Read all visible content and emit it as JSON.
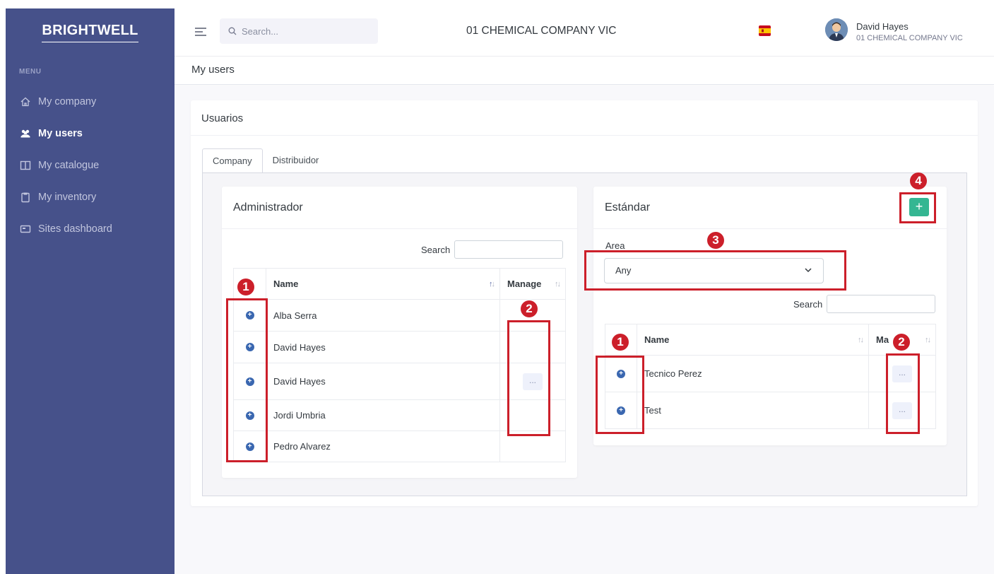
{
  "brand": "BRIGHTWELL",
  "sidebar": {
    "menu_title": "MENU",
    "items": [
      {
        "label": "My company",
        "icon": "home-icon"
      },
      {
        "label": "My users",
        "icon": "users-icon"
      },
      {
        "label": "My catalogue",
        "icon": "book-icon"
      },
      {
        "label": "My inventory",
        "icon": "clipboard-icon"
      },
      {
        "label": "Sites dashboard",
        "icon": "dashboard-icon"
      }
    ],
    "active_index": 1
  },
  "topbar": {
    "search_placeholder": "Search...",
    "company": "01 CHEMICAL COMPANY VIC",
    "user_name": "David Hayes",
    "user_company": "01 CHEMICAL COMPANY VIC",
    "language_flag": "spain-flag-icon"
  },
  "page_title": "My users",
  "card_title": "Usuarios",
  "tabs": [
    "Company",
    "Distribuidor"
  ],
  "admin_panel": {
    "title": "Administrador",
    "search_label": "Search",
    "columns": [
      "Name",
      "Manage"
    ],
    "rows": [
      {
        "name": "Alba Serra",
        "manage": false
      },
      {
        "name": "David Hayes",
        "manage": false
      },
      {
        "name": "David Hayes",
        "manage": true
      },
      {
        "name": "Jordi Umbria",
        "manage": false
      },
      {
        "name": "Pedro Alvarez",
        "manage": false
      }
    ],
    "manage_label": "..."
  },
  "standard_panel": {
    "title": "Estándar",
    "add_label": "+",
    "area_label": "Area",
    "area_value": "Any",
    "search_label": "Search",
    "columns": [
      "Name",
      "Ma"
    ],
    "rows": [
      {
        "name": "Tecnico Perez",
        "manage": true
      },
      {
        "name": "Test",
        "manage": true
      }
    ],
    "manage_label": "..."
  },
  "annotations": {
    "labels": [
      "1",
      "2",
      "1",
      "2",
      "3",
      "4"
    ],
    "color": "#cc1f2a"
  },
  "colors": {
    "sidebar": "#46518a",
    "accent_green": "#34b692",
    "plus_blue": "#3a67b0"
  }
}
